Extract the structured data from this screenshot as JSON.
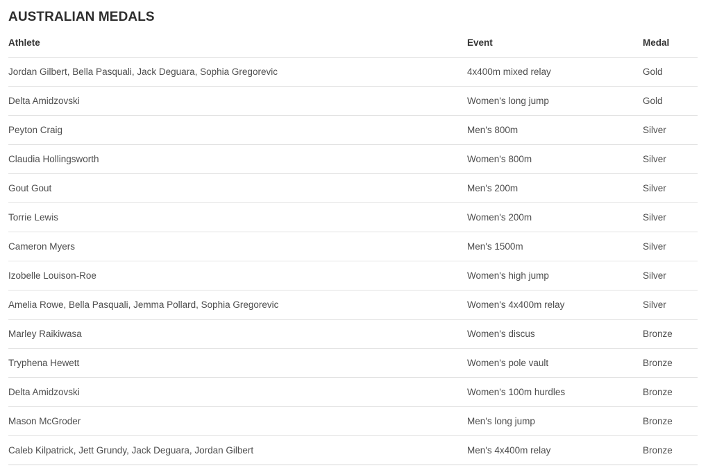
{
  "page": {
    "title": "AUSTRALIAN MEDALS",
    "background_color": "#ffffff",
    "title_color": "#2e2e2e",
    "body_text_color": "#4d4d4d",
    "header_text_color": "#333333",
    "row_divider_color": "#e3e3e3"
  },
  "table": {
    "columns": [
      {
        "key": "athlete",
        "label": "Athlete"
      },
      {
        "key": "event",
        "label": "Event"
      },
      {
        "key": "medal",
        "label": "Medal"
      }
    ],
    "rows": [
      {
        "athlete": "Jordan Gilbert, Bella Pasquali, Jack Deguara, Sophia Gregorevic",
        "event": "4x400m mixed relay",
        "medal": "Gold"
      },
      {
        "athlete": "Delta Amidzovski",
        "event": "Women's long jump",
        "medal": "Gold"
      },
      {
        "athlete": "Peyton Craig",
        "event": "Men's 800m",
        "medal": "Silver"
      },
      {
        "athlete": "Claudia Hollingsworth",
        "event": "Women's 800m",
        "medal": "Silver"
      },
      {
        "athlete": "Gout Gout",
        "event": "Men's 200m",
        "medal": "Silver"
      },
      {
        "athlete": "Torrie Lewis",
        "event": "Women's 200m",
        "medal": "Silver"
      },
      {
        "athlete": "Cameron Myers",
        "event": "Men's 1500m",
        "medal": "Silver"
      },
      {
        "athlete": "Izobelle Louison-Roe",
        "event": "Women's high jump",
        "medal": "Silver"
      },
      {
        "athlete": "Amelia Rowe, Bella Pasquali, Jemma Pollard, Sophia Gregorevic",
        "event": "Women's 4x400m relay",
        "medal": "Silver"
      },
      {
        "athlete": "Marley Raikiwasa",
        "event": "Women's discus",
        "medal": "Bronze"
      },
      {
        "athlete": "Tryphena Hewett",
        "event": "Women's pole vault",
        "medal": "Bronze"
      },
      {
        "athlete": "Delta Amidzovski",
        "event": "Women's 100m hurdles",
        "medal": "Bronze"
      },
      {
        "athlete": "Mason McGroder",
        "event": "Men's long jump",
        "medal": "Bronze"
      },
      {
        "athlete": "Caleb Kilpatrick, Jett Grundy, Jack Deguara, Jordan Gilbert",
        "event": "Men's 4x400m relay",
        "medal": "Bronze"
      }
    ]
  }
}
